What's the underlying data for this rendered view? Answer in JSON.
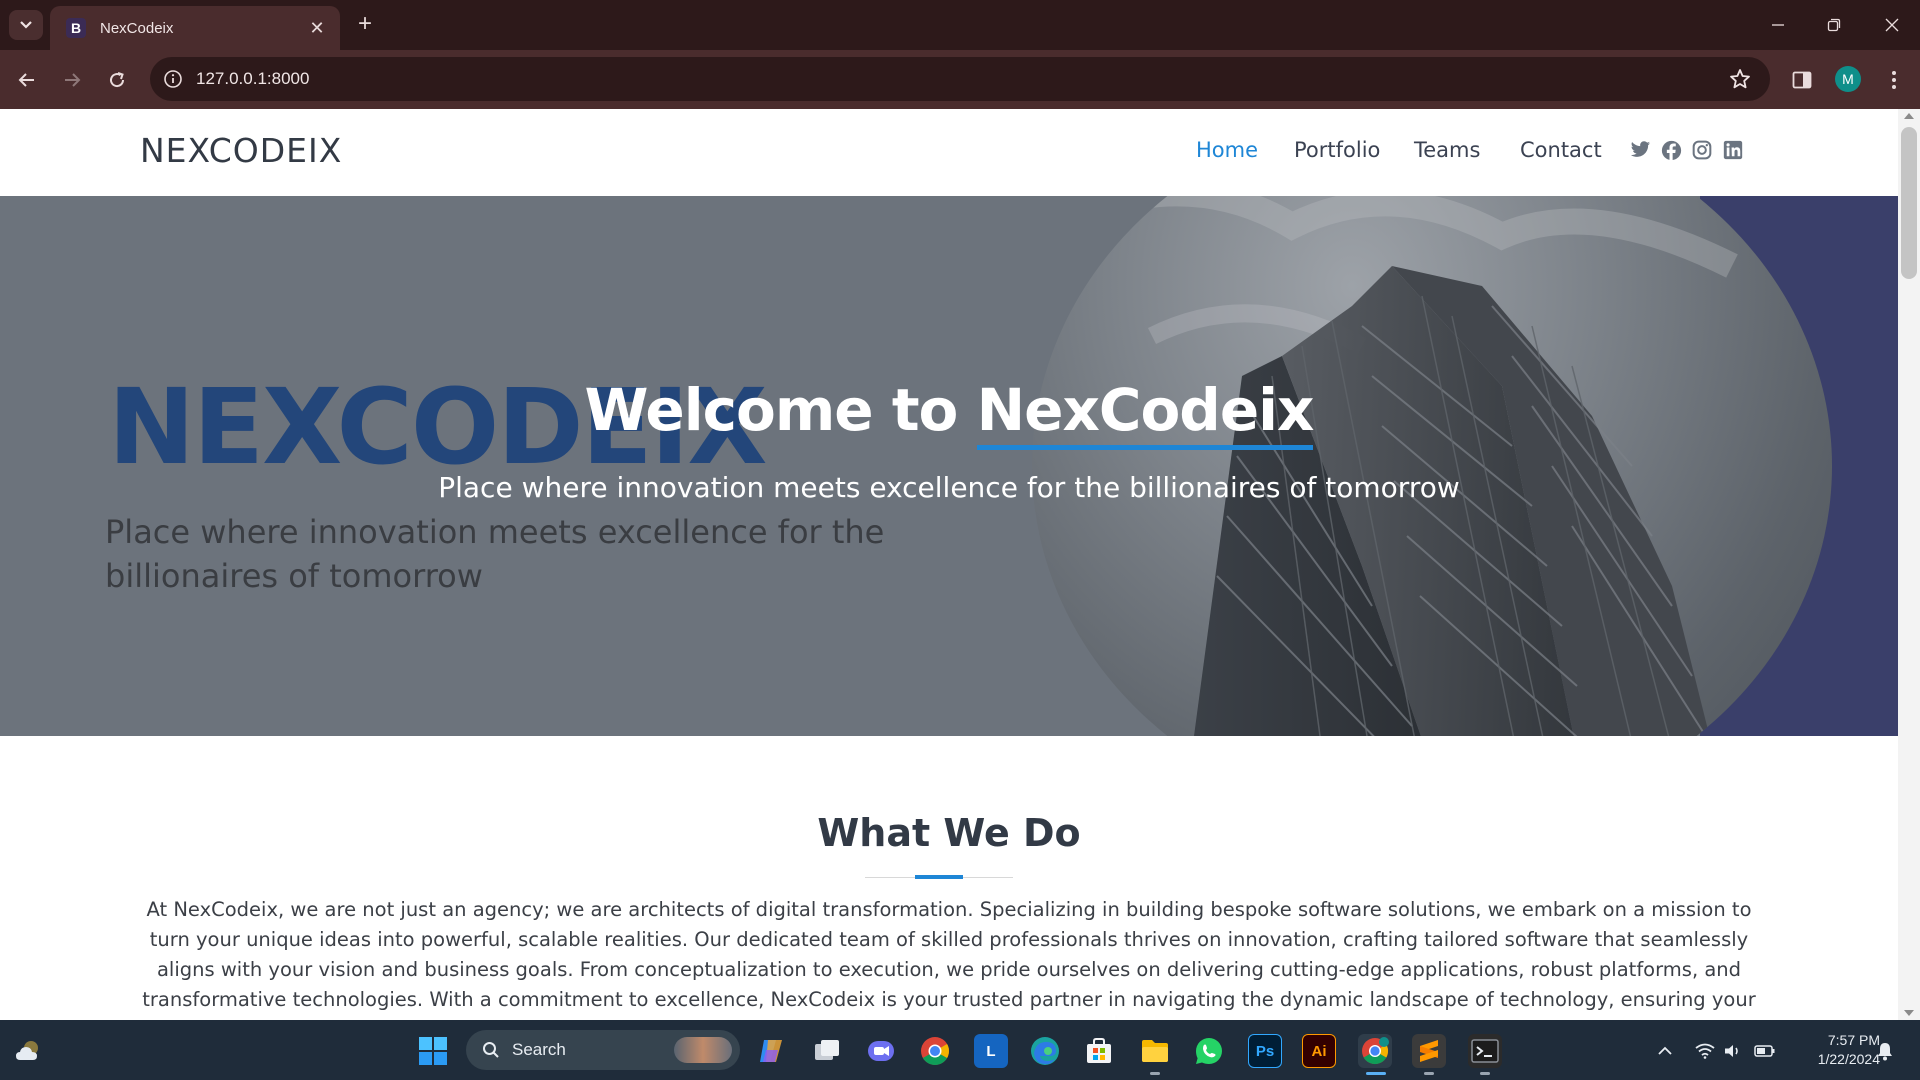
{
  "browser": {
    "tab_title": "NexCodeix",
    "favicon_letter": "B",
    "url": "127.0.0.1:8000",
    "profile_initial": "M"
  },
  "site": {
    "brand": "NEXCODEIX",
    "nav": [
      "Home",
      "Portfolio",
      "Teams",
      "Contact"
    ],
    "active_nav": "Home",
    "social_icons": [
      "twitter-icon",
      "facebook-icon",
      "instagram-icon",
      "linkedin-icon"
    ],
    "accent_color": "#1e86d6"
  },
  "hero": {
    "background_brand": "NEXCODEIX",
    "background_tagline": "Place where innovation meets excellence for the billionaires of tomorrow",
    "title_prefix": "Welcome to ",
    "title_highlight": "NexCodeix",
    "subtitle": "Place where innovation meets excellence for the billionaires of tomorrow"
  },
  "section": {
    "title": "What We Do",
    "body": "At NexCodeix, we are not just an agency; we are architects of digital transformation. Specializing in building bespoke software solutions, we embark on a mission to turn your unique ideas into powerful, scalable realities. Our dedicated team of skilled professionals thrives on innovation, crafting tailored software that seamlessly aligns with your vision and business goals. From conceptualization to execution, we pride ourselves on delivering cutting-edge applications, robust platforms, and transformative technologies. With a commitment to excellence, NexCodeix is your trusted partner in navigating the dynamic landscape of technology, ensuring your digital footprint leaves"
  },
  "taskbar": {
    "search_placeholder": "Search",
    "apps": [
      "copilot-icon",
      "task-view-icon",
      "teams-chat-icon",
      "chrome-icon",
      "l-app-icon",
      "edge-icon",
      "microsoft-store-icon",
      "file-explorer-icon",
      "whatsapp-icon",
      "photoshop-icon",
      "illustrator-icon",
      "chrome-profile-icon",
      "sublime-text-icon",
      "terminal-icon"
    ],
    "photoshop_label": "Ps",
    "illustrator_label": "Ai",
    "l_app_label": "L",
    "time": "7:57 PM",
    "date": "1/22/2024"
  }
}
